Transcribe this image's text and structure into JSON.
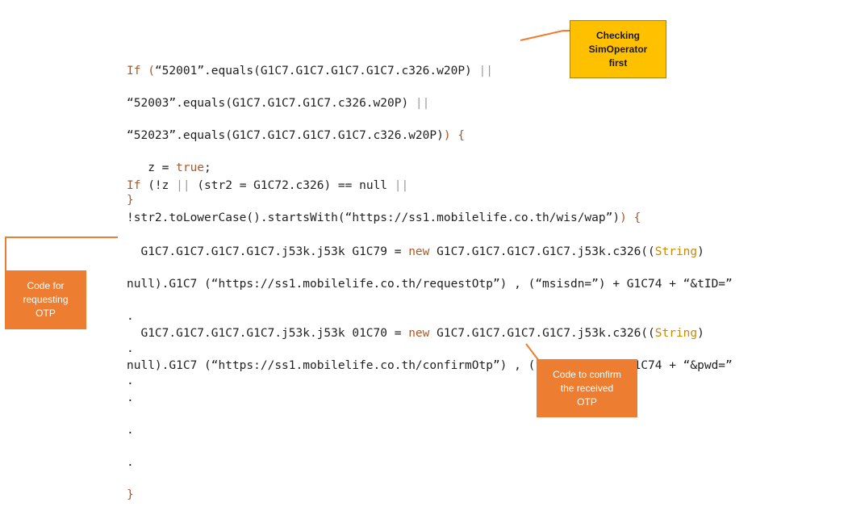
{
  "block1": {
    "line1_kw": "If",
    "line1_open": " (",
    "line1_rest": "“52001”.equals(G1C7.G1C7.G1C7.G1C7.c326.w20P)",
    "line1_or": " ||",
    "line2": "“52003”.equals(G1C7.G1C7.G1C7.c326.w20P)",
    "line2_or": " ||",
    "line3": "“52023”.equals(G1C7.G1C7.G1C7.G1C7.c326.w20P)",
    "line3_close": ") {",
    "line4_indent": "   z = ",
    "line4_true": "true",
    "line4_end": ";",
    "line5": "}"
  },
  "block2": {
    "line1_kw": "If",
    "line1_a": " (!z ",
    "line1_or1": "||",
    "line1_b": " (str2 = G1C72.c326) == null ",
    "line1_or2": "||",
    "line2_a": "!str2.toLowerCase().startsWith(“https://ss1.mobilelife.co.th/wis/wap”)",
    "line2_b": ") {"
  },
  "block3": {
    "line1_a": "  G1C7.G1C7.G1C7.G1C7.j53k.j53k G1C79 = ",
    "line1_new": "new",
    "line1_b": " G1C7.G1C7.G1C7.G1C7.j53k.c326((",
    "line1_type": "String",
    "line1_c": ")",
    "line2_a": "null).G1C7 (“https://ss1.mobilelife.co.th/requestOtp”)",
    "line2_b": " , (“msisdn=”) + G1C74 + “&tID=”",
    "dots": [
      ".",
      ".",
      "."
    ]
  },
  "block4": {
    "line1_a": "  G1C7.G1C7.G1C7.G1C7.j53k.j53k 01C70 = ",
    "line1_new": "new",
    "line1_b": " G1C7.G1C7.G1C7.G1C7.j53k.c326((",
    "line1_type": "String",
    "line1_c": ")",
    "line2_a": "null).G1C7 (“https://ss1.mobilelife.co.th/confirmOtp”)",
    "line2_b": " , (“msisdn=”) + G1C74 + “&pwd=”",
    "dots": [
      ".",
      ".",
      "."
    ],
    "close": "}"
  },
  "callouts": {
    "sim_operator": [
      "Checking",
      "SimOperator",
      "first"
    ],
    "request_otp": [
      "Code for",
      "requesting",
      "OTP"
    ],
    "confirm_otp": [
      "Code to confirm",
      "the received",
      "OTP"
    ]
  },
  "colors": {
    "keyword": "#a9592b",
    "type": "#c78a00",
    "callout_orange": "#ed7d31",
    "callout_yellow": "#ffc000"
  }
}
